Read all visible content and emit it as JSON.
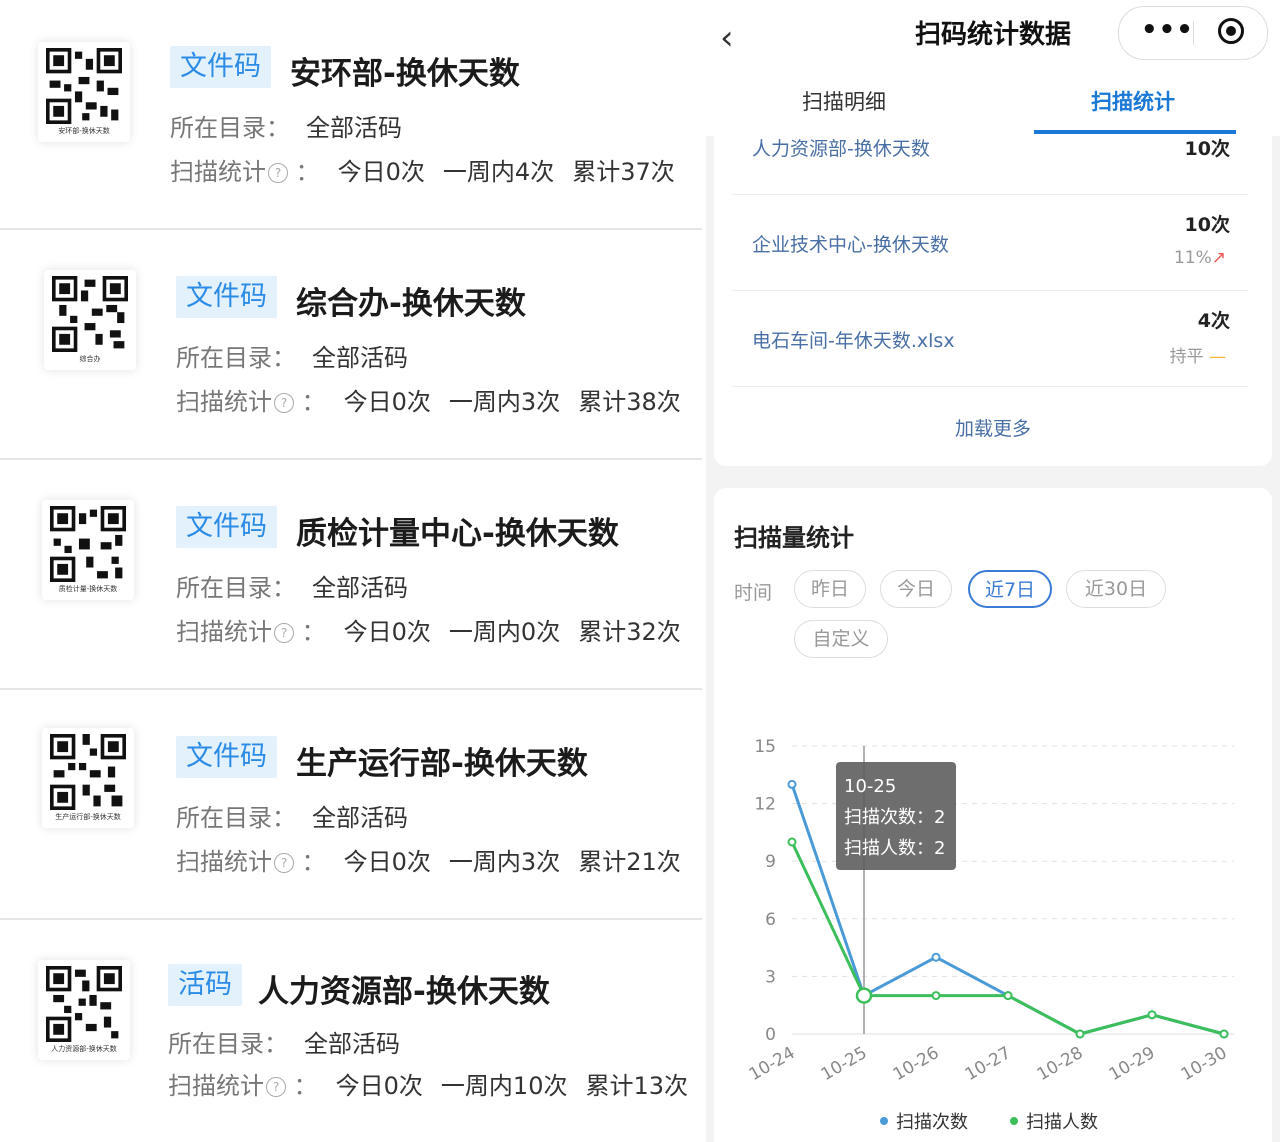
{
  "cards": [
    {
      "tag": "文件码",
      "title": "安环部-换休天数",
      "dir_label": "所在目录：",
      "dir_value": "全部活码",
      "stat_label": "扫描统计",
      "today": "今日0次",
      "week": "一周内4次",
      "total": "累计37次",
      "qr_caption": "安环部-换休天数"
    },
    {
      "tag": "文件码",
      "title": "综合办-换休天数",
      "dir_label": "所在目录：",
      "dir_value": "全部活码",
      "stat_label": "扫描统计",
      "today": "今日0次",
      "week": "一周内3次",
      "total": "累计38次",
      "qr_caption": "综合办"
    },
    {
      "tag": "文件码",
      "title": "质检计量中心-换休天数",
      "dir_label": "所在目录：",
      "dir_value": "全部活码",
      "stat_label": "扫描统计",
      "today": "今日0次",
      "week": "一周内0次",
      "total": "累计32次",
      "qr_caption": "质检计量-换休天数"
    },
    {
      "tag": "文件码",
      "title": "生产运行部-换休天数",
      "dir_label": "所在目录：",
      "dir_value": "全部活码",
      "stat_label": "扫描统计",
      "today": "今日0次",
      "week": "一周内3次",
      "total": "累计21次",
      "qr_caption": "生产运行部-换休天数"
    },
    {
      "tag": "活码",
      "title": "人力资源部-换休天数",
      "dir_label": "所在目录：",
      "dir_value": "全部活码",
      "stat_label": "扫描统计",
      "today": "今日0次",
      "week": "一周内10次",
      "total": "累计13次",
      "qr_caption": "人力资源部-换休天数"
    }
  ],
  "header": {
    "back": "‹",
    "title": "扫码统计数据",
    "menu": "•••"
  },
  "tabs": [
    {
      "label": "扫描明细"
    },
    {
      "label": "扫描统计"
    }
  ],
  "scan_list": [
    {
      "name": "人力资源部-换休天数",
      "count": "10次",
      "trend": ""
    },
    {
      "name": "企业技术中心-换休天数",
      "count": "10次",
      "trend": "11%",
      "trend_icon": "↗"
    },
    {
      "name": "电石车间-年休天数.xlsx",
      "count": "4次",
      "trend": "持平",
      "trend_icon": "—"
    }
  ],
  "load_more": "加载更多",
  "chart_section": {
    "title": "扫描量统计",
    "time_label": "时间",
    "filters": [
      "昨日",
      "今日",
      "近7日",
      "近30日",
      "自定义"
    ],
    "active_filter": "近7日"
  },
  "chart_data": {
    "type": "line",
    "categories": [
      "10-24",
      "10-25",
      "10-26",
      "10-27",
      "10-28",
      "10-29",
      "10-30"
    ],
    "ylim": [
      0,
      15
    ],
    "yticks": [
      0,
      3,
      6,
      9,
      12,
      15
    ],
    "series": [
      {
        "name": "扫描次数",
        "color": "#4a9ad8",
        "values": [
          13,
          2,
          4,
          2,
          0,
          1,
          0
        ]
      },
      {
        "name": "扫描人数",
        "color": "#3cbf5a",
        "values": [
          10,
          2,
          2,
          2,
          0,
          1,
          0
        ]
      }
    ],
    "tooltip": {
      "category": "10-25",
      "lines": [
        "扫描次数：2",
        "扫描人数：2"
      ]
    }
  },
  "colors": {
    "accent": "#1a78d6",
    "tag_bg": "#e3f1fd"
  }
}
